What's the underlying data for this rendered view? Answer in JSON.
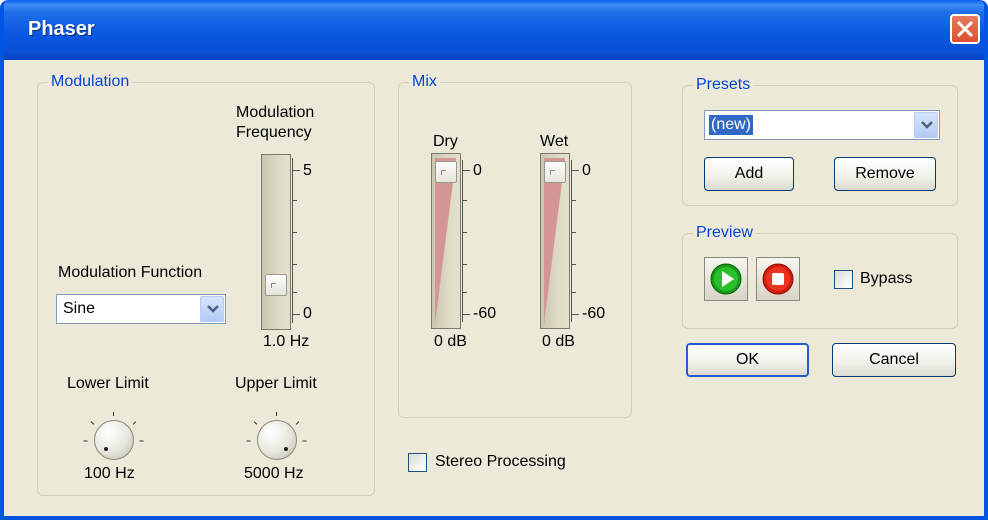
{
  "window": {
    "title": "Phaser"
  },
  "modulation": {
    "group_label": "Modulation",
    "frequency_label_1": "Modulation",
    "frequency_label_2": "Frequency",
    "freq_max_label": "5",
    "freq_min_label": "0",
    "freq_value_label": "1.0 Hz",
    "function_label": "Modulation Function",
    "function_value": "Sine",
    "lower_limit_label": "Lower Limit",
    "lower_limit_value": "100 Hz",
    "upper_limit_label": "Upper Limit",
    "upper_limit_value": "5000 Hz"
  },
  "mix": {
    "group_label": "Mix",
    "dry_label": "Dry",
    "wet_label": "Wet",
    "dry_top": "0",
    "dry_bottom": "-60",
    "dry_value": "0 dB",
    "wet_top": "0",
    "wet_bottom": "-60",
    "wet_value": "0 dB"
  },
  "stereo_processing": {
    "label": "Stereo Processing",
    "checked": false
  },
  "presets": {
    "group_label": "Presets",
    "selected": "(new)",
    "add_label": "Add",
    "remove_label": "Remove"
  },
  "preview": {
    "group_label": "Preview",
    "bypass_label": "Bypass",
    "bypass_checked": false
  },
  "buttons": {
    "ok_label": "OK",
    "cancel_label": "Cancel"
  },
  "colors": {
    "titlebar": "#0a58e0",
    "group_label": "#0046d5",
    "play": "#1a9a1a",
    "stop": "#d41b0e"
  }
}
